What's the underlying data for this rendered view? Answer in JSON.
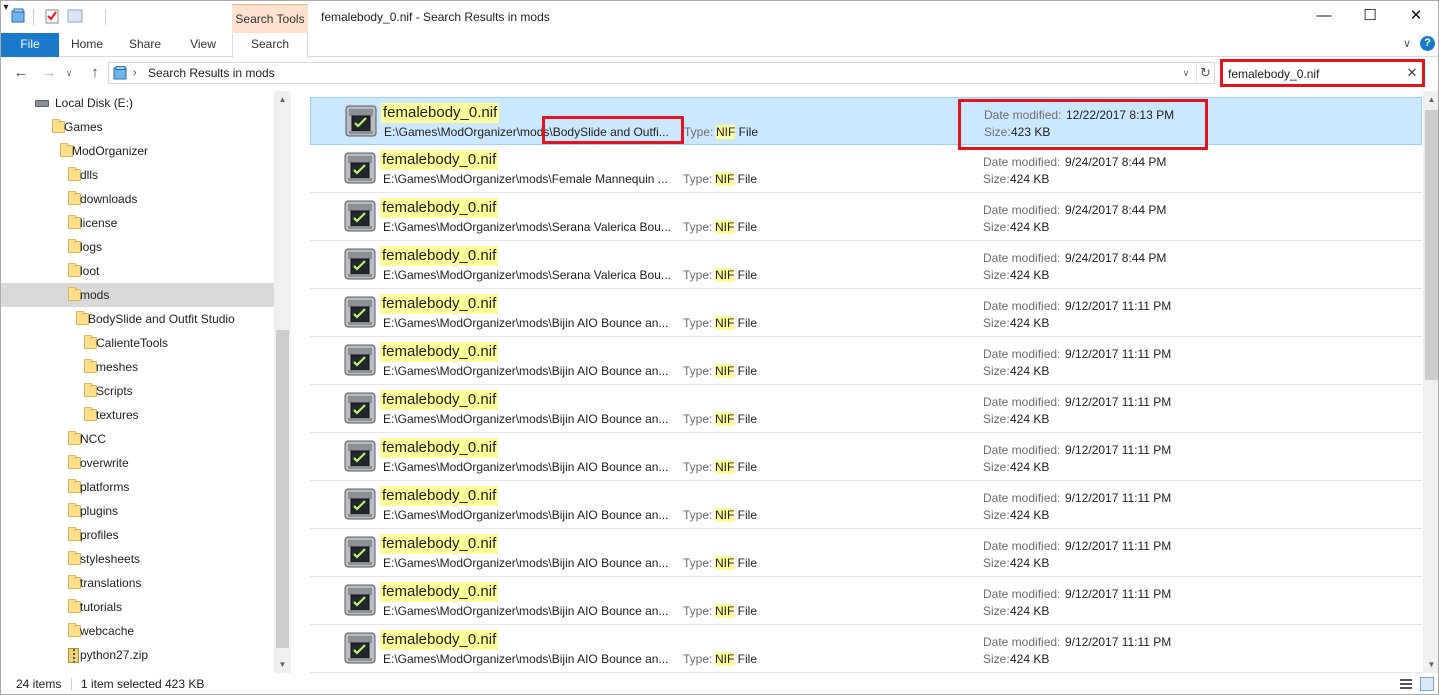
{
  "window": {
    "title": "femalebody_0.nif - Search Results in mods"
  },
  "titlebar": {
    "minimize_label": "—",
    "maximize_label": "☐",
    "close_label": "✕",
    "qa_dropdown": "▾"
  },
  "ribbon": {
    "context_group": "Search Tools",
    "tabs": {
      "file": "File",
      "home": "Home",
      "share": "Share",
      "view": "View",
      "search": "Search"
    },
    "expand": "∨",
    "help": "?"
  },
  "nav": {
    "back": "←",
    "forward": "→",
    "recent": "∨",
    "up": "↑",
    "address_chevron": "›",
    "address": "Search Results in mods",
    "address_dropdown": "∨",
    "refresh": "↻"
  },
  "search": {
    "value": "femalebody_0.nif",
    "clear": "✕"
  },
  "sidebar": {
    "items": [
      {
        "label": "Local Disk (E:)",
        "icon": "drive-icon",
        "level": 0
      },
      {
        "label": "Games",
        "icon": "folder-icon",
        "level": 1
      },
      {
        "label": "ModOrganizer",
        "icon": "folder-icon",
        "level": 2
      },
      {
        "label": "dlls",
        "icon": "folder-icon",
        "level": 3
      },
      {
        "label": "downloads",
        "icon": "folder-icon",
        "level": 3
      },
      {
        "label": "license",
        "icon": "folder-icon",
        "level": 3
      },
      {
        "label": "logs",
        "icon": "folder-icon",
        "level": 3
      },
      {
        "label": "loot",
        "icon": "folder-icon",
        "level": 3
      },
      {
        "label": "mods",
        "icon": "folder-icon",
        "level": 3,
        "selected": true
      },
      {
        "label": "BodySlide and Outfit Studio",
        "icon": "folder-icon",
        "level": 4
      },
      {
        "label": "CalienteTools",
        "icon": "folder-icon",
        "level": 5
      },
      {
        "label": "meshes",
        "icon": "folder-icon",
        "level": 5
      },
      {
        "label": "Scripts",
        "icon": "folder-icon",
        "level": 5
      },
      {
        "label": "textures",
        "icon": "folder-icon",
        "level": 5
      },
      {
        "label": "NCC",
        "icon": "folder-icon",
        "level": 3
      },
      {
        "label": "overwrite",
        "icon": "folder-icon",
        "level": 3
      },
      {
        "label": "platforms",
        "icon": "folder-icon",
        "level": 3
      },
      {
        "label": "plugins",
        "icon": "folder-icon",
        "level": 3
      },
      {
        "label": "profiles",
        "icon": "folder-icon",
        "level": 3
      },
      {
        "label": "stylesheets",
        "icon": "folder-icon",
        "level": 3
      },
      {
        "label": "translations",
        "icon": "folder-icon",
        "level": 3
      },
      {
        "label": "tutorials",
        "icon": "folder-icon",
        "level": 3
      },
      {
        "label": "webcache",
        "icon": "folder-icon",
        "level": 3
      },
      {
        "label": "python27.zip",
        "icon": "zip-icon",
        "level": 3
      }
    ]
  },
  "results": {
    "labels": {
      "type": "Type:",
      "date": "Date modified:",
      "size": "Size:"
    },
    "type_highlight": "NIF",
    "type_rest": " File",
    "items": [
      {
        "name": "femalebody_0.nif",
        "path": "E:\\Games\\ModOrganizer\\mods\\BodySlide and Outfi...",
        "date": "12/22/2017 8:13 PM",
        "size": "423 KB",
        "selected": true
      },
      {
        "name": "femalebody_0.nif",
        "path": "E:\\Games\\ModOrganizer\\mods\\Female Mannequin ...",
        "date": "9/24/2017 8:44 PM",
        "size": "424 KB"
      },
      {
        "name": "femalebody_0.nif",
        "path": "E:\\Games\\ModOrganizer\\mods\\Serana Valerica Bou...",
        "date": "9/24/2017 8:44 PM",
        "size": "424 KB"
      },
      {
        "name": "femalebody_0.nif",
        "path": "E:\\Games\\ModOrganizer\\mods\\Serana Valerica Bou...",
        "date": "9/24/2017 8:44 PM",
        "size": "424 KB"
      },
      {
        "name": "femalebody_0.nif",
        "path": "E:\\Games\\ModOrganizer\\mods\\Bijin AIO Bounce an...",
        "date": "9/12/2017 11:11 PM",
        "size": "424 KB"
      },
      {
        "name": "femalebody_0.nif",
        "path": "E:\\Games\\ModOrganizer\\mods\\Bijin AIO Bounce an...",
        "date": "9/12/2017 11:11 PM",
        "size": "424 KB"
      },
      {
        "name": "femalebody_0.nif",
        "path": "E:\\Games\\ModOrganizer\\mods\\Bijin AIO Bounce an...",
        "date": "9/12/2017 11:11 PM",
        "size": "424 KB"
      },
      {
        "name": "femalebody_0.nif",
        "path": "E:\\Games\\ModOrganizer\\mods\\Bijin AIO Bounce an...",
        "date": "9/12/2017 11:11 PM",
        "size": "424 KB"
      },
      {
        "name": "femalebody_0.nif",
        "path": "E:\\Games\\ModOrganizer\\mods\\Bijin AIO Bounce an...",
        "date": "9/12/2017 11:11 PM",
        "size": "424 KB"
      },
      {
        "name": "femalebody_0.nif",
        "path": "E:\\Games\\ModOrganizer\\mods\\Bijin AIO Bounce an...",
        "date": "9/12/2017 11:11 PM",
        "size": "424 KB"
      },
      {
        "name": "femalebody_0.nif",
        "path": "E:\\Games\\ModOrganizer\\mods\\Bijin AIO Bounce an...",
        "date": "9/12/2017 11:11 PM",
        "size": "424 KB"
      },
      {
        "name": "femalebody_0.nif",
        "path": "E:\\Games\\ModOrganizer\\mods\\Bijin AIO Bounce an...",
        "date": "9/12/2017 11:11 PM",
        "size": "424 KB"
      }
    ]
  },
  "status": {
    "count": "24 items",
    "selected": "1 item selected",
    "size": "423 KB"
  },
  "colors": {
    "accent": "#1979ca",
    "selection": "#cce8ff",
    "highlight": "#fdfd9a",
    "annotation": "#e3151b",
    "context_tab": "#fde2d0"
  },
  "scrollbars": {
    "arrow_up": "▲",
    "arrow_down": "▼"
  }
}
